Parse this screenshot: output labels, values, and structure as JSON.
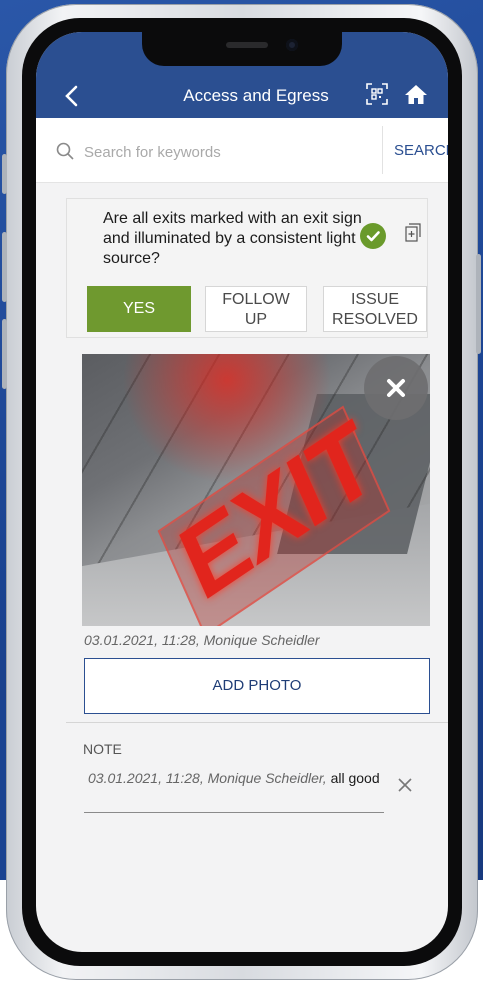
{
  "header": {
    "title": "Access and Egress",
    "back_icon": "chevron-left-icon",
    "qr_icon": "qr-scan-icon",
    "home_icon": "home-icon",
    "background": "#2b4f91"
  },
  "search": {
    "placeholder": "Search for keywords",
    "value": "",
    "button_label": "SEARCH",
    "icon": "search-icon"
  },
  "question": {
    "text": "Are all exits marked with an exit sign and illuminated by a consistent light source?",
    "status_icon": "check-circle-icon",
    "copy_icon": "copy-add-icon",
    "accent": "#6f992f",
    "options": [
      {
        "label": "YES",
        "selected": true
      },
      {
        "label_line1": "FOLLOW",
        "label_line2": "UP",
        "selected": false
      },
      {
        "label_line1": "ISSUE",
        "label_line2": "RESOLVED",
        "selected": false
      }
    ]
  },
  "photo": {
    "sign_text": "EXIT",
    "caption": "03.01.2021, 11:28, Monique Scheidler",
    "remove_icon": "close-icon"
  },
  "add_photo_label": "ADD PHOTO",
  "note": {
    "label": "NOTE",
    "meta": "03.01.2021, 11:28,  Monique Scheidler,",
    "text": " all good",
    "clear_icon": "close-icon"
  }
}
